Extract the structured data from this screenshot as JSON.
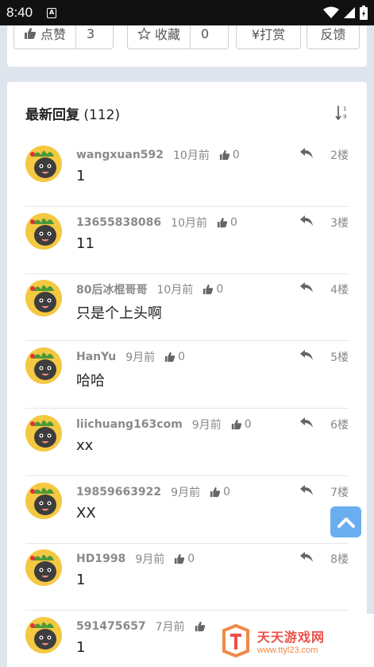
{
  "status_bar": {
    "time": "8:40",
    "notif": "A"
  },
  "actions": {
    "like_label": "点赞",
    "like_count": "3",
    "fav_label": "收藏",
    "fav_count": "0",
    "tip_label": "¥打赏",
    "feedback_label": "反馈"
  },
  "replies_section": {
    "title": "最新回复",
    "count": "(112)"
  },
  "replies": [
    {
      "user": "wangxuan592",
      "time": "10月前",
      "likes": "0",
      "floor": "2楼",
      "content": "1"
    },
    {
      "user": "13655838086",
      "time": "10月前",
      "likes": "0",
      "floor": "3楼",
      "content": "11"
    },
    {
      "user": "80后冰棍哥哥",
      "time": "10月前",
      "likes": "0",
      "floor": "4楼",
      "content": "只是个上头啊"
    },
    {
      "user": "HanYu",
      "time": "9月前",
      "likes": "0",
      "floor": "5楼",
      "content": "哈哈"
    },
    {
      "user": "liichuang163com",
      "time": "9月前",
      "likes": "0",
      "floor": "6楼",
      "content": "xx"
    },
    {
      "user": "19859663922",
      "time": "9月前",
      "likes": "0",
      "floor": "7楼",
      "content": "XX"
    },
    {
      "user": "HD1998",
      "time": "9月前",
      "likes": "0",
      "floor": "8楼",
      "content": "1"
    },
    {
      "user": "591475657",
      "time": "7月前",
      "likes": "",
      "floor": "",
      "content": "1"
    }
  ],
  "watermark": {
    "name": "天天游戏网",
    "url": "www.ttyl23.com"
  },
  "colors": {
    "accent": "#6aaef0",
    "watermark": "#e9504a"
  }
}
